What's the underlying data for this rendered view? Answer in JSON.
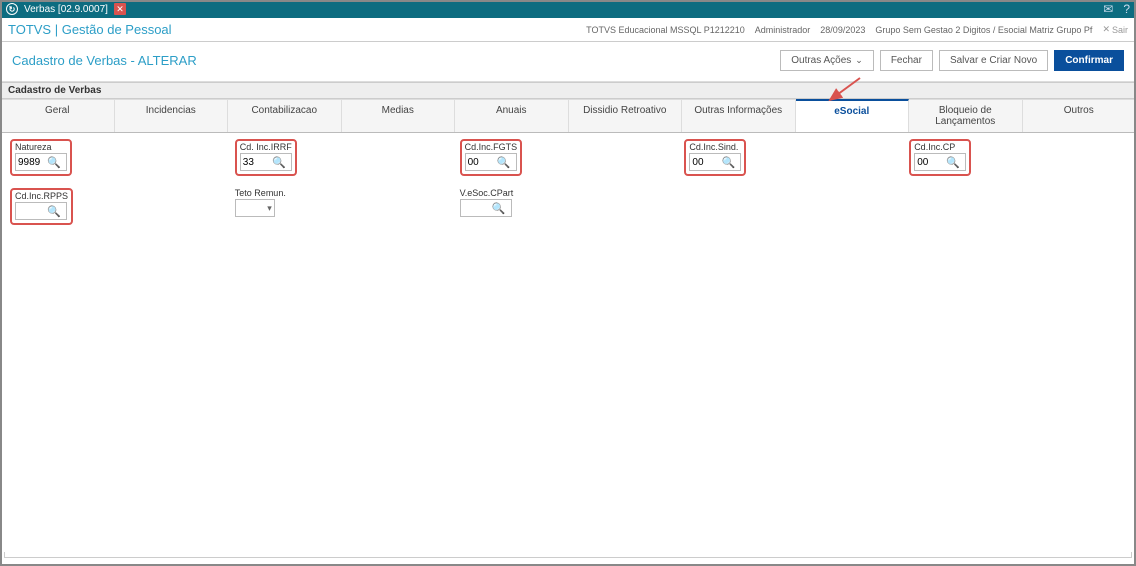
{
  "titlebar": {
    "app_icon_glyph": "↻",
    "title": "Verbas [02.9.0007]"
  },
  "appbar": {
    "brand": "TOTVS | Gestão de Pessoal",
    "env": "TOTVS Educacional MSSQL P1212210",
    "user": "Administrador",
    "date": "28/09/2023",
    "group": "Grupo Sem Gestao 2 Digitos / Esocial Matriz Grupo Pf",
    "exit": "Sair"
  },
  "subheader": {
    "title": "Cadastro de Verbas - ALTERAR",
    "btn_actions": "Outras Ações",
    "btn_close": "Fechar",
    "btn_save_new": "Salvar e Criar Novo",
    "btn_confirm": "Confirmar"
  },
  "section": {
    "label": "Cadastro de Verbas"
  },
  "tabs": [
    {
      "label": "Geral"
    },
    {
      "label": "Incidencias"
    },
    {
      "label": "Contabilizacao"
    },
    {
      "label": "Medias"
    },
    {
      "label": "Anuais"
    },
    {
      "label": "Dissidio Retroativo"
    },
    {
      "label": "Outras Informações"
    },
    {
      "label": "eSocial",
      "active": true
    },
    {
      "label": "Bloqueio de Lançamentos"
    },
    {
      "label": "Outros"
    }
  ],
  "fields": {
    "natureza": {
      "label": "Natureza",
      "value": "9989",
      "highlight": true,
      "type": "lookup"
    },
    "cd_inc_irrf": {
      "label": "Cd. Inc.IRRF",
      "value": "33",
      "highlight": true,
      "type": "lookup"
    },
    "cd_inc_fgts": {
      "label": "Cd.Inc.FGTS",
      "value": "00",
      "highlight": true,
      "type": "lookup"
    },
    "cd_inc_sind": {
      "label": "Cd.Inc.Sind.",
      "value": "00",
      "highlight": true,
      "type": "lookup"
    },
    "cd_inc_cp": {
      "label": "Cd.Inc.CP",
      "value": "00",
      "highlight": true,
      "type": "lookup"
    },
    "cd_inc_rpps": {
      "label": "Cd.Inc.RPPS",
      "value": "",
      "highlight": true,
      "type": "lookup"
    },
    "teto_remun": {
      "label": "Teto Remun.",
      "value": "",
      "highlight": false,
      "type": "dropdown"
    },
    "vesoc_cpart": {
      "label": "V.eSoc.CPart",
      "value": "",
      "highlight": false,
      "type": "lookup"
    }
  }
}
